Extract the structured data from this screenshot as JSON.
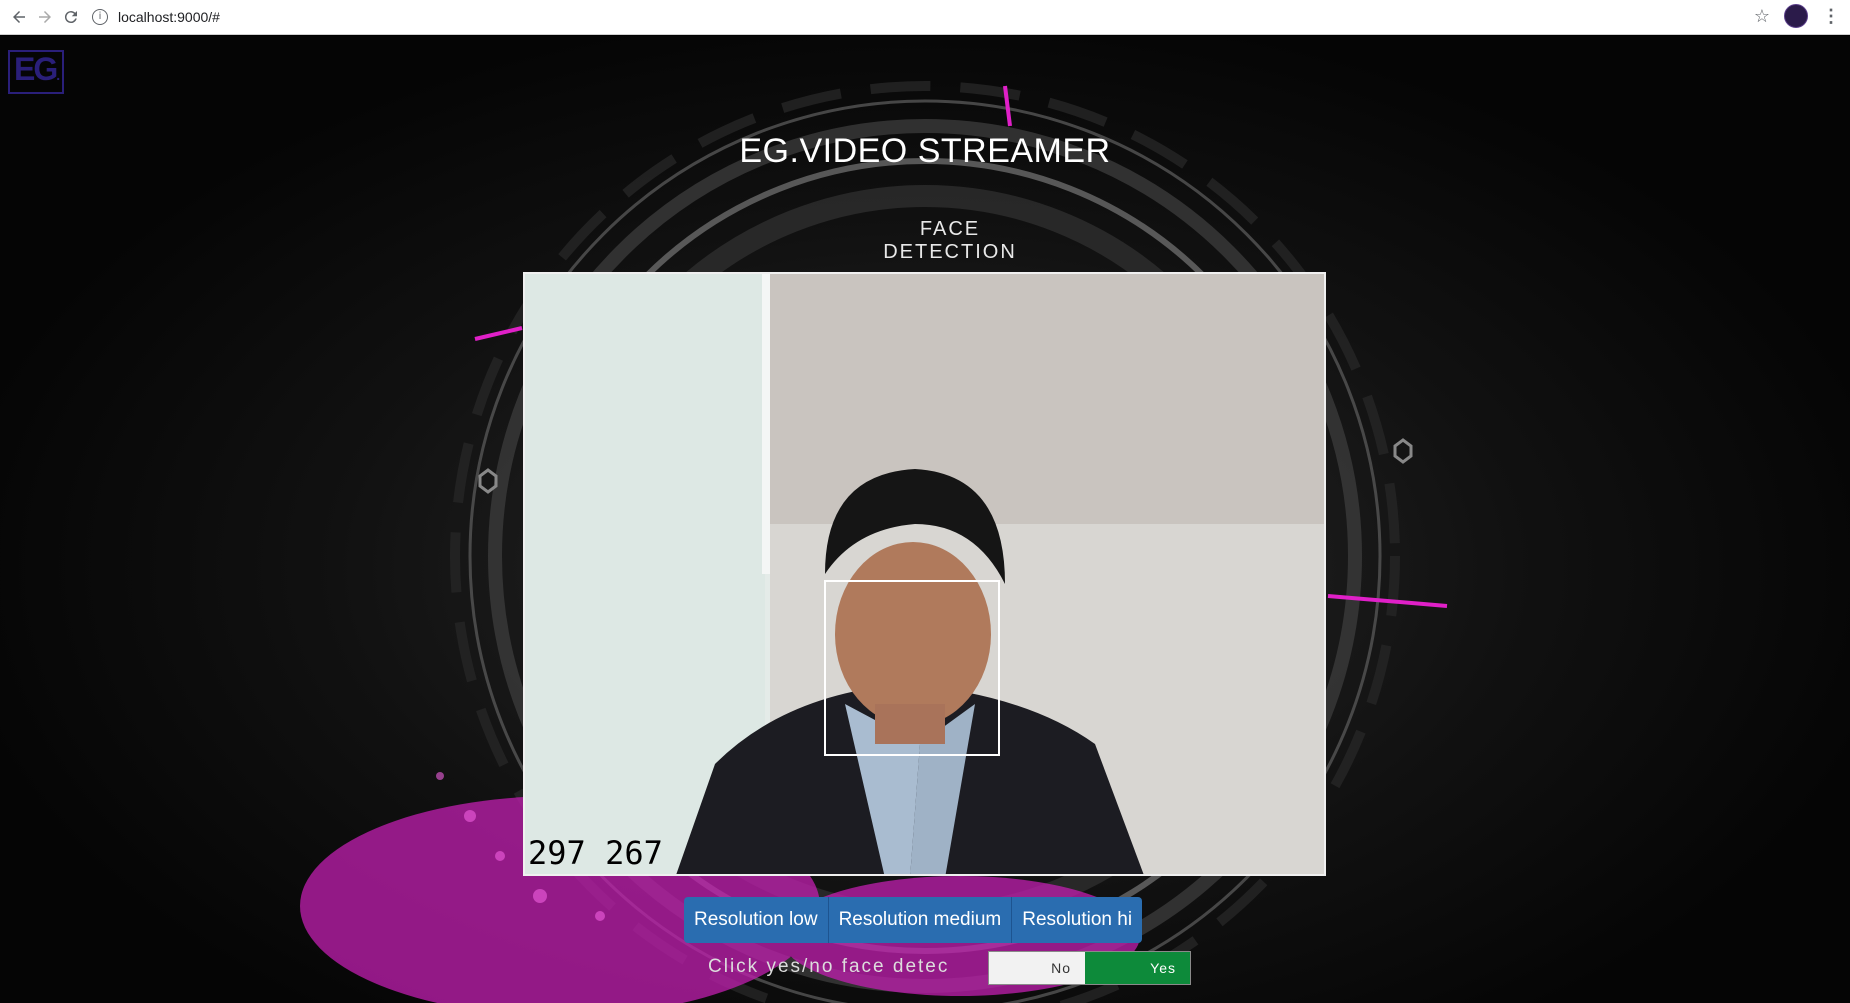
{
  "browser": {
    "url": "localhost:9000/#",
    "info_icon": "i"
  },
  "logo": {
    "text": "EG",
    "suffix": "."
  },
  "header": {
    "title": "EG.VIDEO STREAMER",
    "subtitle": "FACE DETECTION"
  },
  "video": {
    "overlay_text": "297 267",
    "face_box_color": "#ffffff"
  },
  "resolution_buttons": [
    {
      "label": "Resolution low"
    },
    {
      "label": "Resolution medium"
    },
    {
      "label": "Resolution hi"
    }
  ],
  "face_toggle": {
    "label": "Click yes/no face detec",
    "no_label": "No",
    "yes_label": "Yes",
    "selected": "Yes"
  },
  "colors": {
    "accent_magenta": "#e020c8",
    "button_blue": "#2a6db0",
    "toggle_green": "#0d8a3a"
  }
}
